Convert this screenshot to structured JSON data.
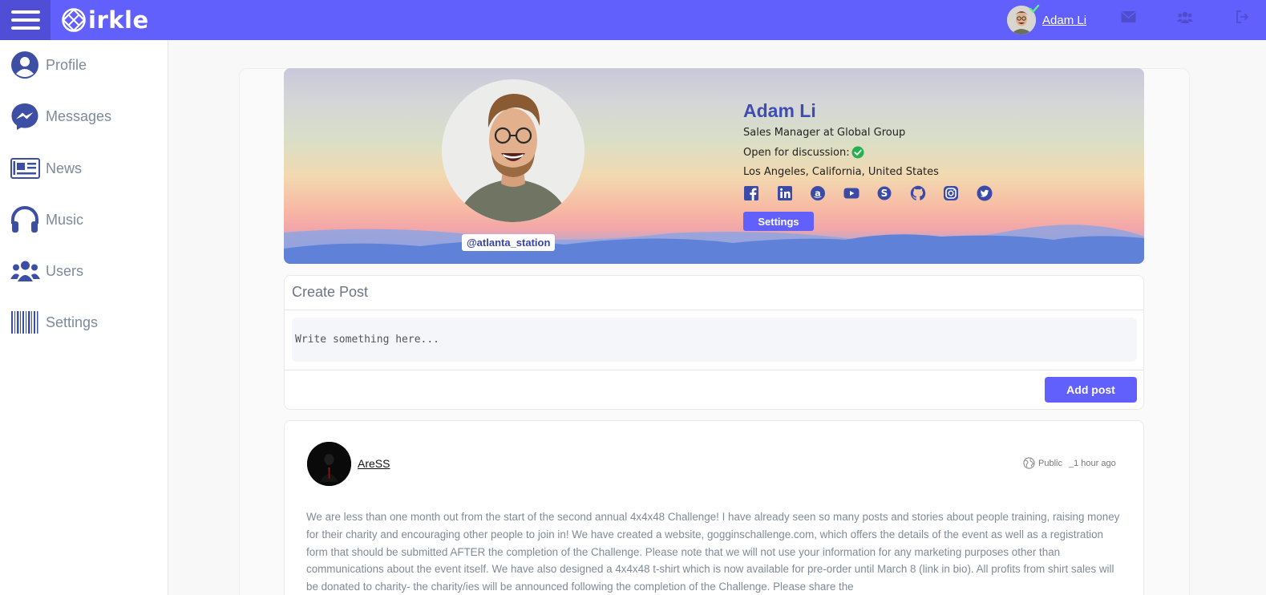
{
  "brand": {
    "name": "irkle",
    "logo_icon": "circle-lattice-logo"
  },
  "topbar": {
    "menu_icon": "hamburger-icon",
    "user_name": "Adam Li",
    "icons": [
      "envelope-icon",
      "users-icon",
      "sign-out-icon"
    ],
    "accent_color": "#6160fc"
  },
  "sidebar": {
    "items": [
      {
        "label": "Profile",
        "icon": "user-circle-icon"
      },
      {
        "label": "Messages",
        "icon": "messenger-icon"
      },
      {
        "label": "News",
        "icon": "newspaper-icon"
      },
      {
        "label": "Music",
        "icon": "headphones-icon"
      },
      {
        "label": "Users",
        "icon": "users-icon"
      },
      {
        "label": "Settings",
        "icon": "barcode-icon"
      }
    ]
  },
  "profile": {
    "name": "Adam Li",
    "handle": "@atlanta_station",
    "title": "Sales Manager at Global Group",
    "open_label": "Open for discussion:",
    "location": "Los Angeles, California, United States",
    "socials": [
      "facebook-icon",
      "linkedin-icon",
      "amazon-icon",
      "youtube-icon",
      "skype-icon",
      "github-icon",
      "instagram-icon",
      "twitter-icon"
    ],
    "settings_label": "Settings"
  },
  "create_post": {
    "title": "Create Post",
    "placeholder": "Write something here...",
    "button_label": "Add post"
  },
  "post": {
    "author": "AreSS",
    "visibility": "Public",
    "time": "_1 hour ago",
    "text": "We are less than one month out from the start of the second annual 4x4x48 Challenge! I have already seen so many posts and stories about people training, raising money for their charity and encouraging other people to join in! We have created a website, gogginschallenge.com, which offers the details of the event as well as a registration form that should be submitted AFTER the completion of the Challenge. Please note that we will not use your information for any marketing purposes other than communications about the event itself. We have also designed a 4x4x48 t-shirt which is now available for pre-order until March 8 (link in bio). All profits from shirt sales will be donated to charity- the charity/ies will be announced following the completion of the Challenge. Please share the"
  }
}
